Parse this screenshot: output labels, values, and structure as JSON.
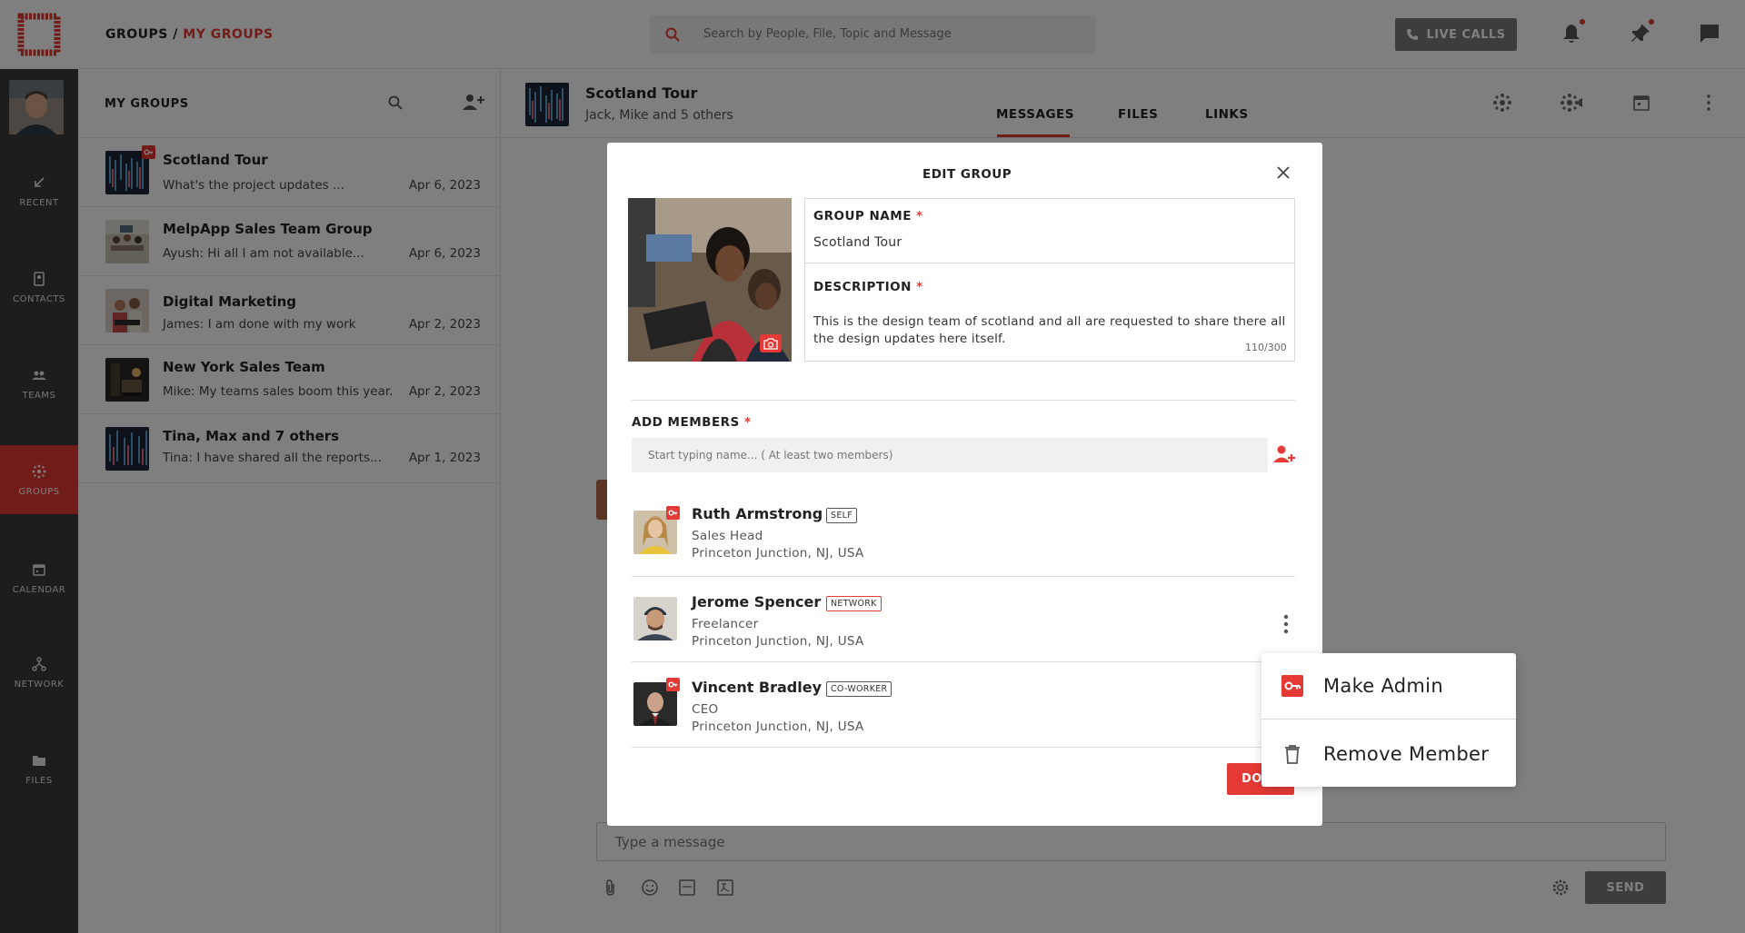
{
  "header": {
    "breadcrumb_root": "GROUPS",
    "breadcrumb_sep": " / ",
    "breadcrumb_current": "MY GROUPS",
    "search_placeholder": "Search by People, File, Topic and Message",
    "live_calls_label": "LIVE CALLS"
  },
  "sidebar": {
    "items": [
      {
        "label": "RECENT",
        "icon": "arrow-down-left-icon"
      },
      {
        "label": "CONTACTS",
        "icon": "contact-book-icon"
      },
      {
        "label": "TEAMS",
        "icon": "teams-icon"
      },
      {
        "label": "GROUPS",
        "icon": "groups-icon",
        "active": true
      },
      {
        "label": "CALENDAR",
        "icon": "calendar-icon"
      },
      {
        "label": "NETWORK",
        "icon": "network-icon"
      },
      {
        "label": "FILES",
        "icon": "folder-icon"
      }
    ]
  },
  "group_list": {
    "title": "MY GROUPS",
    "groups": [
      {
        "name": "Scotland Tour",
        "message": "What's the project updates ...",
        "date": "Apr 6, 2023",
        "admin": true
      },
      {
        "name": "MelpApp Sales Team Group",
        "message": "Ayush: Hi all I am not available...",
        "date": "Apr 6, 2023"
      },
      {
        "name": "Digital Marketing",
        "message": "James: I am done with my work",
        "date": "Apr 2, 2023"
      },
      {
        "name": "New York Sales Team",
        "message": "Mike: My teams sales boom this year.",
        "date": "Apr 2, 2023"
      },
      {
        "name": "Tina, Max and 7 others",
        "message": "Tina: I have shared all the reports...",
        "date": "Apr 1, 2023"
      }
    ]
  },
  "chat": {
    "title": "Scotland Tour",
    "subtitle": "Jack, Mike and 5 others",
    "tabs": [
      "MESSAGES",
      "FILES",
      "LINKS"
    ],
    "active_tab": "MESSAGES",
    "message_placeholder": "Type a message",
    "send_label": "SEND"
  },
  "edit_group": {
    "title": "EDIT GROUP",
    "group_name_label": "GROUP NAME",
    "group_name_value": "Scotland Tour",
    "description_label": "DESCRIPTION",
    "description_value": "This is the design team of scotland and all are requested to share there all the design updates here itself.",
    "char_count": "110/300",
    "required_mark": "*",
    "add_members_label": "ADD MEMBERS",
    "add_members_placeholder": "Start typing name... ( At least two members)",
    "done_label": "DONE",
    "members": [
      {
        "name": "Ruth Armstrong",
        "tag": "SELF",
        "role": "Sales Head",
        "location": "Princeton Junction, NJ, USA",
        "admin": true
      },
      {
        "name": "Jerome Spencer",
        "tag": "NETWORK",
        "role": "Freelancer",
        "location": "Princeton Junction, NJ, USA",
        "admin": false
      },
      {
        "name": "Vincent Bradley",
        "tag": "CO-WORKER",
        "role": "CEO",
        "location": "Princeton Junction, NJ, USA",
        "admin": true
      }
    ]
  },
  "context_menu": {
    "items": [
      {
        "label": "Make Admin",
        "icon": "key-icon"
      },
      {
        "label": "Remove Member",
        "icon": "trash-icon"
      }
    ]
  },
  "colors": {
    "accent": "#e53935",
    "sidebar_bg": "#3a3a3a",
    "overlay": "rgba(0,0,0,0.5)"
  }
}
